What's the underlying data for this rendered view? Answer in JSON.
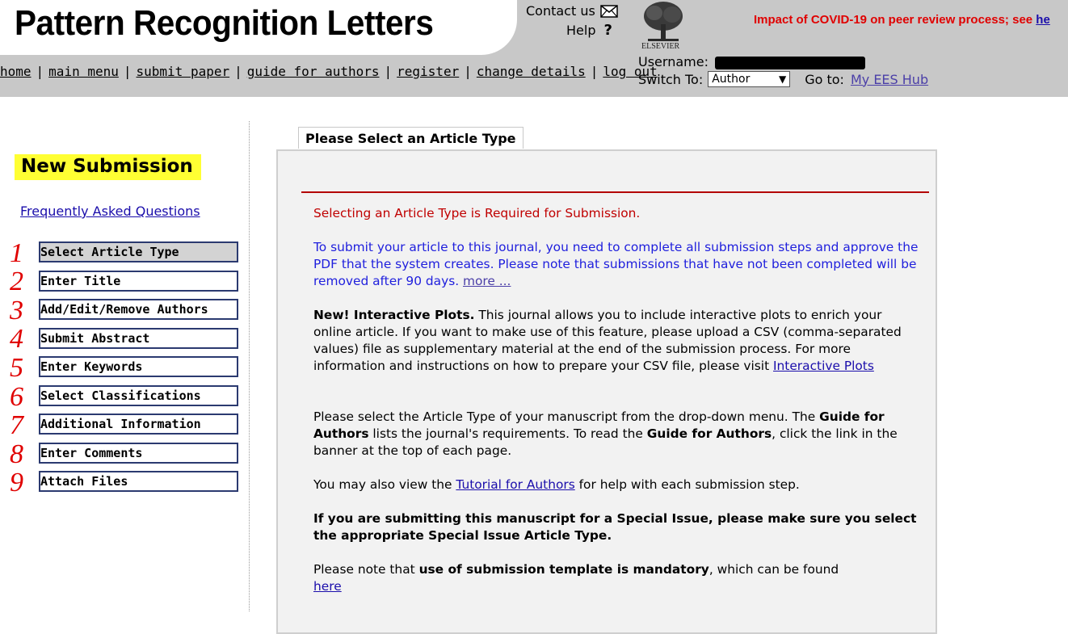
{
  "header": {
    "title": "Pattern Recognition Letters",
    "nav": [
      "home",
      "main menu",
      "submit paper",
      "guide for authors",
      "register",
      "change details",
      "log out"
    ],
    "nav_sep": "|",
    "contact": "Contact us",
    "help": "Help",
    "help_symbol": "?",
    "logo_label": "ELSEVIER",
    "covid_notice": "Impact of COVID-19 on peer review process; see ",
    "covid_link": "he",
    "username_label": "Username:",
    "switch_to_label": "Switch To:",
    "role_selected": "Author",
    "dropdown_arrow": "▼",
    "goto_label": "Go to:",
    "goto_link": "My EES Hub"
  },
  "sidebar": {
    "heading": "New Submission",
    "faq": "Frequently Asked Questions",
    "steps": [
      {
        "label": "Select Article Type",
        "num": "1"
      },
      {
        "label": "Enter Title",
        "num": "2"
      },
      {
        "label": "Add/Edit/Remove Authors",
        "num": "3"
      },
      {
        "label": "Submit Abstract",
        "num": "4"
      },
      {
        "label": "Enter Keywords",
        "num": "5"
      },
      {
        "label": "Select Classifications",
        "num": "6"
      },
      {
        "label": "Additional Information",
        "num": "7"
      },
      {
        "label": "Enter Comments",
        "num": "8"
      },
      {
        "label": "Attach Files",
        "num": "9"
      }
    ]
  },
  "main": {
    "tab_title": "Please Select an Article Type",
    "required_note": "Selecting an Article Type is Required for Submission.",
    "info_text": "To submit your article to this journal, you need to complete all submission steps and approve the PDF that the system creates. Please note that submissions that have not been completed will be removed after 90 days. ",
    "info_more": "more ...",
    "plots_bold": "New! Interactive Plots.",
    "plots_text": " This journal allows you to include interactive plots to enrich your online article. If you want to make use of this feature, please upload a CSV (comma-separated values) file as supplementary material at the end of the submission process. For more information and instructions on how to prepare your CSV file, please visit ",
    "plots_link": "Interactive Plots",
    "select_text_1": "Please select the Article Type of your manuscript from the drop-down menu. The ",
    "select_bold_1": "Guide for Authors",
    "select_text_2": " lists the journal's requirements. To read the ",
    "select_bold_2": "Guide for Authors",
    "select_text_3": ", click the link in the banner at the top of each page.",
    "tutorial_text_1": "You may also view the ",
    "tutorial_link": "Tutorial for Authors",
    "tutorial_text_2": " for help with each submission step.",
    "special_issue": "If you are submitting this manuscript for a Special Issue, please make sure you select the appropriate Special Issue Article Type.",
    "template_text_1": "Please note that ",
    "template_bold": "use of submission template is mandatory",
    "template_text_2": ", which can be found ",
    "template_link": "here"
  }
}
